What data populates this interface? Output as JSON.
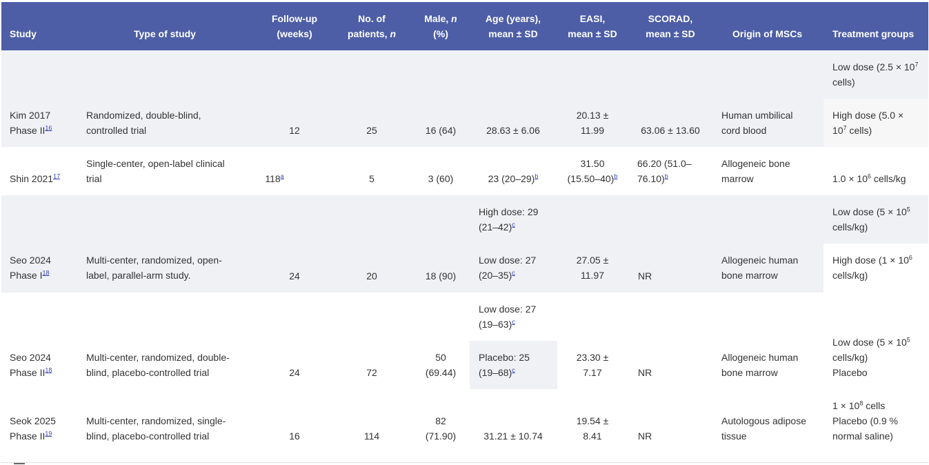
{
  "headers": {
    "study": "Study",
    "type": "Type of study",
    "follow1": "Follow-up",
    "follow2": "(weeks)",
    "pat1": "No. of",
    "pat2": "patients, ",
    "pat2i": "n",
    "male1": "Male, ",
    "male1i": "n",
    "male2": "(%)",
    "age1": "Age (years),",
    "age2": "mean ± SD",
    "easi1": "EASI,",
    "easi2": "mean ± SD",
    "scorad1": "SCORAD,",
    "scorad2": "mean ± SD",
    "origin": "Origin of MSCs",
    "treat": "Treatment groups"
  },
  "rows": [
    {
      "study1": "Kim 2017",
      "study2": "Phase II",
      "ref": "16",
      "type1": "Randomized, double-blind,",
      "type2": "controlled trial",
      "follow": "12",
      "patients": "25",
      "male": "16 (64)",
      "age": "28.63 ± 6.06",
      "easi1": "20.13 ±",
      "easi2": "11.99",
      "scorad": "63.06 ± 13.60",
      "origin1": "Human umbilical",
      "origin2": "cord blood",
      "t1a": "Low dose (2.5 × 10",
      "t1sup": "7",
      "t1b": "cells)",
      "t2a": "High dose (5.0 ×",
      "t2b": "10",
      "t2sup": "7",
      "t2c": " cells)"
    },
    {
      "study": "Shin 2021",
      "ref": "17",
      "type1": "Single-center, open-label clinical",
      "type2": "trial",
      "follow": "118",
      "follow_note": "a",
      "patients": "5",
      "male": "3 (60)",
      "age": "23 (20–29)",
      "age_note": "b",
      "easi1": "31.50",
      "easi2": "(15.50–40)",
      "easi_note": "b",
      "scorad1": "66.20 (51.0–",
      "scorad2": "76.10)",
      "scorad_note": "b",
      "origin1": "Allogeneic bone",
      "origin2": "marrow",
      "treat_a": "1.0 × 10",
      "treat_sup": "6",
      "treat_b": " cells/kg"
    },
    {
      "study1": "Seo 2024",
      "study2": "Phase I",
      "ref": "18",
      "type1": "Multi-center, randomized, open-",
      "type2": "label, parallel-arm study.",
      "follow": "24",
      "patients": "20",
      "male": "18 (90)",
      "age_high1": "High dose: 29",
      "age_high2": "(21–42)",
      "age_low1": "Low dose: 27",
      "age_low2": "(20–35)",
      "age_note": "c",
      "easi1": "27.05 ±",
      "easi2": "11.97",
      "scorad": "NR",
      "origin1": "Allogeneic human",
      "origin2": "bone marrow",
      "t1a": "Low dose (5 × 10",
      "t1sup": "5",
      "t1b": "cells/kg)",
      "t2a": "High dose (1 × 10",
      "t2sup": "6",
      "t2b": "cells/kg)"
    },
    {
      "study1": "Seo 2024",
      "study2": "Phase II",
      "ref": "18",
      "type1": "Multi-center, randomized, double-",
      "type2": "blind, placebo-controlled trial",
      "follow": "24",
      "patients": "72",
      "male1": "50",
      "male2": "(69.44)",
      "age_low1": "Low dose: 27",
      "age_low2": "(19–63)",
      "age_plac1": "Placebo: 25",
      "age_plac2": "(19–68)",
      "age_note": "c",
      "easi1": "23.30 ±",
      "easi2": "7.17",
      "scorad": "NR",
      "origin1": "Allogeneic human",
      "origin2": "bone marrow",
      "t1a": "Low dose (5 × 10",
      "t1sup": "5",
      "t1b": "cells/kg)",
      "t2": "Placebo"
    },
    {
      "study1": "Seok 2025",
      "study2": "Phase II",
      "ref": "19",
      "type1": "Multi-center, randomized, single-",
      "type2": "blind, placebo-controlled trial",
      "follow": "16",
      "patients": "114",
      "male1": "82",
      "male2": "(71.90)",
      "age": "31.21 ± 10.74",
      "easi1": "19.54 ±",
      "easi2": "8.41",
      "scorad": "NR",
      "origin1": "Autologous adipose",
      "origin2": "tissue",
      "t1a": "1 × 10",
      "t1sup": "8",
      "t1b": " cells",
      "t2a": "Placebo (0.9 %",
      "t2b": "normal saline)"
    }
  ]
}
